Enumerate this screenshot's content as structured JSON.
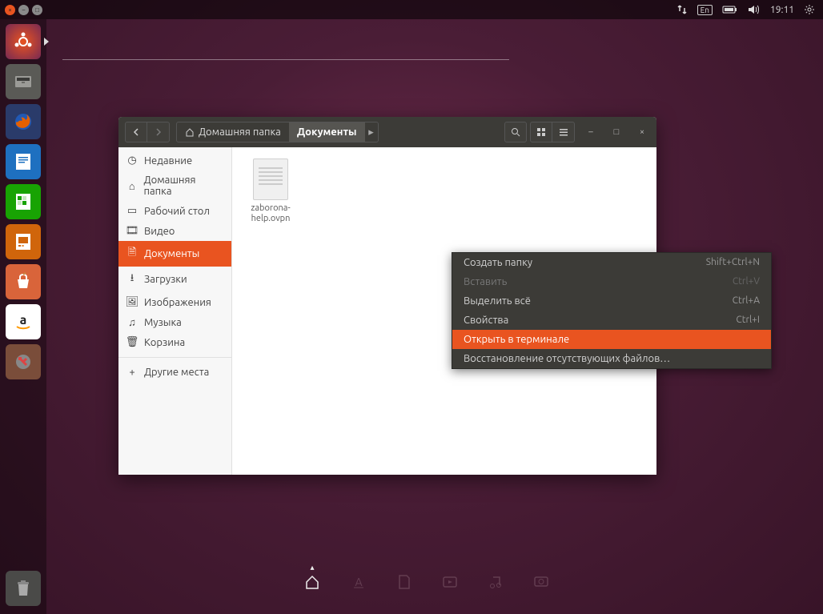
{
  "top_panel": {
    "lang": "En",
    "time": "19:11"
  },
  "launcher": {
    "items": [
      "dash",
      "files",
      "firefox",
      "writer",
      "calc",
      "impress",
      "software",
      "amazon",
      "settings"
    ]
  },
  "nautilus": {
    "breadcrumb": {
      "home": "Домашняя папка",
      "current": "Документы"
    },
    "sidebar": {
      "recent": "Недавние",
      "home": "Домашняя папка",
      "desktop": "Рабочий стол",
      "videos": "Видео",
      "documents": "Документы",
      "downloads": "Загрузки",
      "pictures": "Изображения",
      "music": "Музыка",
      "trash": "Корзина",
      "other": "Другие места"
    },
    "file": {
      "name": "zaborona-help.ovpn"
    }
  },
  "context_menu": {
    "items": [
      {
        "label": "Создать папку",
        "shortcut": "Shift+Ctrl+N",
        "disabled": false
      },
      {
        "label": "Вставить",
        "shortcut": "Ctrl+V",
        "disabled": true
      },
      {
        "label": "Выделить всё",
        "shortcut": "Ctrl+A",
        "disabled": false
      },
      {
        "label": "Свойства",
        "shortcut": "Ctrl+I",
        "disabled": false
      },
      {
        "label": "Открыть в терминале",
        "shortcut": "",
        "disabled": false,
        "active": true
      },
      {
        "label": "Восстановление отсутствующих файлов…",
        "shortcut": "",
        "disabled": false
      }
    ]
  }
}
